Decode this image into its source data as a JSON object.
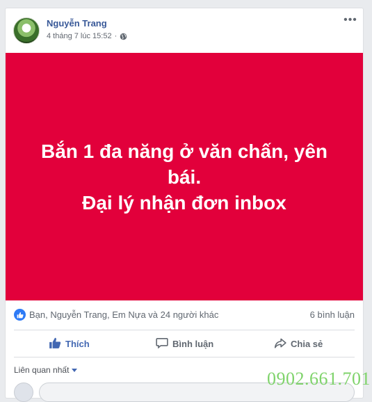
{
  "post": {
    "author": "Nguyễn Trang",
    "timestamp": "4 tháng 7 lúc 15:52",
    "separator": "·",
    "privacy_icon": "globe-icon",
    "more_label": "•••",
    "banner": {
      "text": "Bắn 1 đa năng ở văn chấn, yên\nbái.\nĐại lý nhận đơn inbox",
      "background": "#e2003b",
      "text_color": "#ffffff"
    },
    "reactions_text": "Bạn, Nguyễn Trang, Em Nựa và 24 người khác",
    "comments_count": "6 bình luận"
  },
  "actions": {
    "like_label": "Thích",
    "comment_label": "Bình luận",
    "share_label": "Chia sẻ"
  },
  "comments": {
    "sort_label": "Liên quan nhất"
  },
  "watermark": "0902.661.701",
  "colors": {
    "link": "#385898",
    "accent": "#4267b2",
    "like_badge": "#2e7bf6"
  }
}
